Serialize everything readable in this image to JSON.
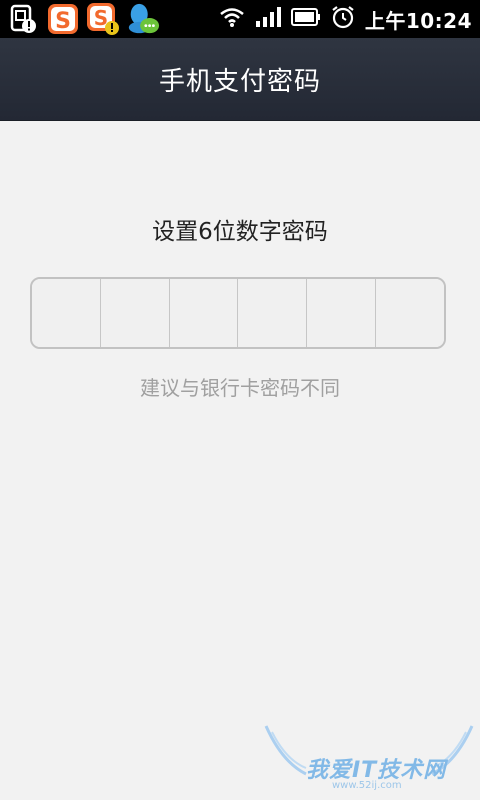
{
  "status_bar": {
    "notifications": [
      "sim-warning-icon",
      "sogou-icon",
      "sogou-alert-icon",
      "qq-chat-icon"
    ],
    "system_icons": [
      "wifi-icon",
      "signal-icon",
      "battery-icon",
      "alarm-icon"
    ],
    "time": "上午10:24"
  },
  "header": {
    "title": "手机支付密码"
  },
  "main": {
    "prompt": "设置6位数字密码",
    "pin_length": 6,
    "hint": "建议与银行卡密码不同"
  },
  "watermark": {
    "text": "我爱IT技术网",
    "sub": "www.52ij.com"
  },
  "colors": {
    "title_bar": "#2a303c",
    "background": "#f2f2f2",
    "hint": "#a0a0a0"
  }
}
